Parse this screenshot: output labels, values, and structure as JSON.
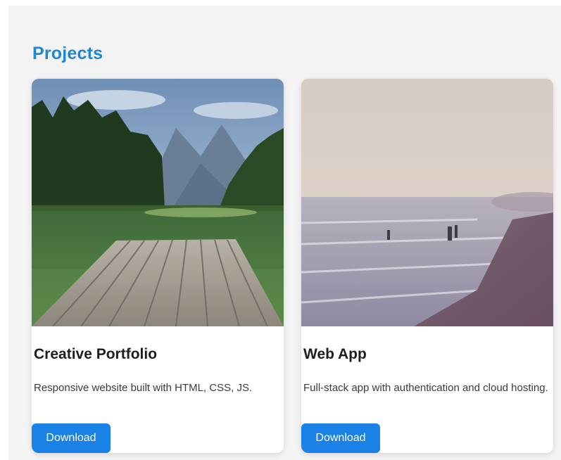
{
  "section": {
    "title": "Projects"
  },
  "projects": [
    {
      "title": "Creative Portfolio",
      "description": "Responsive website built with HTML, CSS, JS.",
      "button_label": "Download",
      "image_subject": "mountain-lake-pier-photo"
    },
    {
      "title": "Web App",
      "description": "Full-stack app with authentication and cloud hosting.",
      "button_label": "Download",
      "image_subject": "misty-beach-photo"
    }
  ],
  "colors": {
    "accent": "#1f86cf",
    "button": "#1a82e6",
    "panel_bg": "#f3f3f3",
    "card_bg": "#ffffff"
  }
}
